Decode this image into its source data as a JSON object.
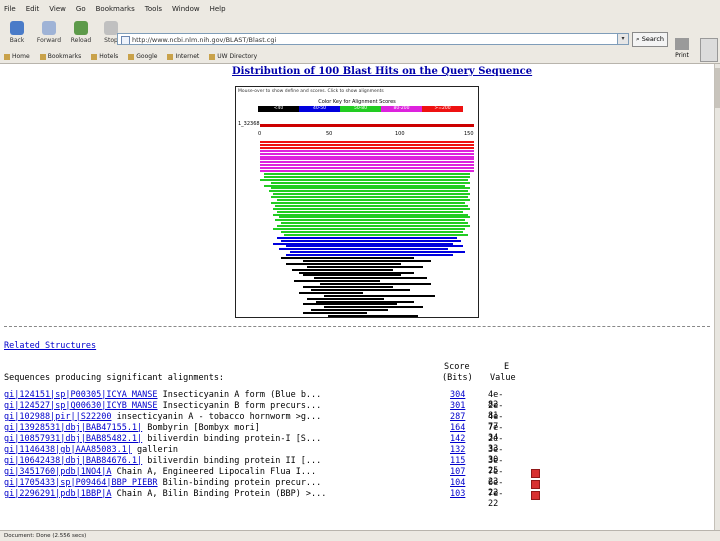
{
  "browser": {
    "menu": [
      "File",
      "Edit",
      "View",
      "Go",
      "Bookmarks",
      "Tools",
      "Window",
      "Help"
    ],
    "nav": {
      "back": "Back",
      "forward": "Forward",
      "reload": "Reload",
      "stop": "Stop",
      "print": "Print"
    },
    "url": "http://www.ncbi.nlm.nih.gov/BLAST/Blast.cgi",
    "search_label": "Search",
    "bookmarks": [
      "Home",
      "Bookmarks",
      "Hotels",
      "Google",
      "Internet",
      "UW Directory"
    ],
    "status": "Document: Done (2.556 secs)"
  },
  "page": {
    "heading": "Distribution of 100 Blast Hits on the Query Sequence",
    "graphic": {
      "note": "Mouse-over to show define and scores. Click to show alignments",
      "key_title": "Color Key for Alignment Scores",
      "key": [
        {
          "label": "<40",
          "color": "#000000"
        },
        {
          "label": "40-50",
          "color": "#0000dd"
        },
        {
          "label": "50-80",
          "color": "#22cc22"
        },
        {
          "label": "80-200",
          "color": "#dd22dd"
        },
        {
          "label": ">=200",
          "color": "#ee1111"
        }
      ],
      "query_label": "1_32368",
      "ticks": [
        "0",
        "50",
        "100",
        "150"
      ]
    },
    "related_link": "Related Structures",
    "table": {
      "header_left": "Sequences producing significant alignments:",
      "score_header_1": "Score",
      "score_header_2": "(Bits)",
      "evalue_header_1": "E",
      "evalue_header_2": "Value",
      "rows": [
        {
          "acc": "gi|124151|sp|P00305|ICYA_MANSE",
          "desc": " Insecticyanin A form (Blue b...",
          "score": "304",
          "evalue": "4e-82"
        },
        {
          "acc": "gi|124527|sp|Q00630|ICYB_MANSE",
          "desc": " Insecticyanin B form precurs...",
          "score": "301",
          "evalue": "2e-81"
        },
        {
          "acc": "gi|102988|pir||S22200",
          "desc": " insecticyanin A - tobacco hornworm >g...",
          "score": "287",
          "evalue": "4e-77"
        },
        {
          "acc": "gi|13928531|dbj|BAB47155.1|",
          "desc": " Bombyrin [Bombyx mori]",
          "score": "164",
          "evalue": "7e-34"
        },
        {
          "acc": "gi|10857931|dbj|BAB85482.1|",
          "desc": " biliverdin binding protein-I [S...",
          "score": "142",
          "evalue": "2e-33"
        },
        {
          "acc": "gi|1146438|gb|AAA85083.1|",
          "desc": " gallerin",
          "score": "132",
          "evalue": "3e-30"
        },
        {
          "acc": "gi|10642438|dbj|BAB84676.1|",
          "desc": " biliverdin binding protein II [...",
          "score": "115",
          "evalue": "3e-25"
        },
        {
          "acc": "gi|3451760|pdb|1NO4|A",
          "desc": " Chain A, Engineered Lipocalin Flua I...",
          "score": "107",
          "evalue": "7e-23"
        },
        {
          "acc": "gi|1705433|sp|P09464|BBP_PIEBR",
          "desc": " Bilin-binding protein precur...",
          "score": "104",
          "evalue": "6e-22"
        },
        {
          "acc": "gi|2296291|pdb|1BBP|A",
          "desc": " Chain A, Bilin Binding Protein (BBP) >...",
          "score": "103",
          "evalue": "7e-22"
        }
      ]
    }
  },
  "hits": [
    {
      "s": 0,
      "e": 1,
      "c": "#ee1111"
    },
    {
      "s": 0,
      "e": 1,
      "c": "#ee1111"
    },
    {
      "s": 0,
      "e": 1,
      "c": "#ee1111"
    },
    {
      "s": 0,
      "e": 1,
      "c": "#dd22dd"
    },
    {
      "s": 0,
      "e": 1,
      "c": "#dd22dd"
    },
    {
      "s": 0,
      "e": 1,
      "c": "#dd22dd"
    },
    {
      "s": 0,
      "e": 1,
      "c": "#dd22dd"
    },
    {
      "s": 0,
      "e": 1,
      "c": "#dd22dd"
    },
    {
      "s": 0,
      "e": 1,
      "c": "#dd22dd"
    },
    {
      "s": 0,
      "e": 1,
      "c": "#dd22dd"
    },
    {
      "s": 0,
      "e": 1,
      "c": "#dd22dd"
    },
    {
      "s": 0.02,
      "e": 0.98,
      "c": "#22cc22"
    },
    {
      "s": 0.02,
      "e": 0.98,
      "c": "#22cc22"
    },
    {
      "s": 0,
      "e": 0.97,
      "c": "#22cc22"
    },
    {
      "s": 0.05,
      "e": 0.98,
      "c": "#22cc22"
    },
    {
      "s": 0.02,
      "e": 0.96,
      "c": "#22cc22"
    },
    {
      "s": 0.05,
      "e": 0.98,
      "c": "#22cc22"
    },
    {
      "s": 0.04,
      "e": 0.97,
      "c": "#22cc22"
    },
    {
      "s": 0.06,
      "e": 0.98,
      "c": "#22cc22"
    },
    {
      "s": 0.05,
      "e": 0.97,
      "c": "#22cc22"
    },
    {
      "s": 0.08,
      "e": 0.98,
      "c": "#22cc22"
    },
    {
      "s": 0.05,
      "e": 0.96,
      "c": "#22cc22"
    },
    {
      "s": 0.07,
      "e": 0.97,
      "c": "#22cc22"
    },
    {
      "s": 0.06,
      "e": 0.98,
      "c": "#22cc22"
    },
    {
      "s": 0.08,
      "e": 0.95,
      "c": "#22cc22"
    },
    {
      "s": 0.06,
      "e": 0.97,
      "c": "#22cc22"
    },
    {
      "s": 0.09,
      "e": 0.98,
      "c": "#22cc22"
    },
    {
      "s": 0.07,
      "e": 0.96,
      "c": "#22cc22"
    },
    {
      "s": 0.1,
      "e": 0.97,
      "c": "#22cc22"
    },
    {
      "s": 0.08,
      "e": 0.98,
      "c": "#22cc22"
    },
    {
      "s": 0.06,
      "e": 0.96,
      "c": "#22cc22"
    },
    {
      "s": 0.1,
      "e": 0.95,
      "c": "#22cc22"
    },
    {
      "s": 0.11,
      "e": 0.97,
      "c": "#22cc22"
    },
    {
      "s": 0.08,
      "e": 0.92,
      "c": "#0000dd"
    },
    {
      "s": 0.1,
      "e": 0.94,
      "c": "#0000dd"
    },
    {
      "s": 0.06,
      "e": 0.9,
      "c": "#0000dd"
    },
    {
      "s": 0.12,
      "e": 0.95,
      "c": "#0000dd"
    },
    {
      "s": 0.09,
      "e": 0.88,
      "c": "#0000dd"
    },
    {
      "s": 0.14,
      "e": 0.96,
      "c": "#0000dd"
    },
    {
      "s": 0.12,
      "e": 0.9,
      "c": "#0000dd"
    },
    {
      "s": 0.1,
      "e": 0.72,
      "c": "#000000"
    },
    {
      "s": 0.2,
      "e": 0.8,
      "c": "#000000"
    },
    {
      "s": 0.12,
      "e": 0.66,
      "c": "#000000"
    },
    {
      "s": 0.22,
      "e": 0.76,
      "c": "#000000"
    },
    {
      "s": 0.15,
      "e": 0.62,
      "c": "#000000"
    },
    {
      "s": 0.18,
      "e": 0.72,
      "c": "#000000"
    },
    {
      "s": 0.2,
      "e": 0.66,
      "c": "#000000"
    },
    {
      "s": 0.25,
      "e": 0.78,
      "c": "#000000"
    },
    {
      "s": 0.16,
      "e": 0.56,
      "c": "#000000"
    },
    {
      "s": 0.28,
      "e": 0.8,
      "c": "#000000"
    },
    {
      "s": 0.2,
      "e": 0.62,
      "c": "#000000"
    },
    {
      "s": 0.24,
      "e": 0.7,
      "c": "#000000"
    },
    {
      "s": 0.18,
      "e": 0.48,
      "c": "#000000"
    },
    {
      "s": 0.3,
      "e": 0.82,
      "c": "#000000"
    },
    {
      "s": 0.22,
      "e": 0.58,
      "c": "#000000"
    },
    {
      "s": 0.26,
      "e": 0.72,
      "c": "#000000"
    },
    {
      "s": 0.2,
      "e": 0.64,
      "c": "#000000"
    },
    {
      "s": 0.3,
      "e": 0.76,
      "c": "#000000"
    },
    {
      "s": 0.24,
      "e": 0.6,
      "c": "#000000"
    },
    {
      "s": 0.2,
      "e": 0.5,
      "c": "#000000"
    },
    {
      "s": 0.32,
      "e": 0.74,
      "c": "#000000"
    },
    {
      "s": 0.22,
      "e": 0.66,
      "c": "#000000"
    }
  ]
}
